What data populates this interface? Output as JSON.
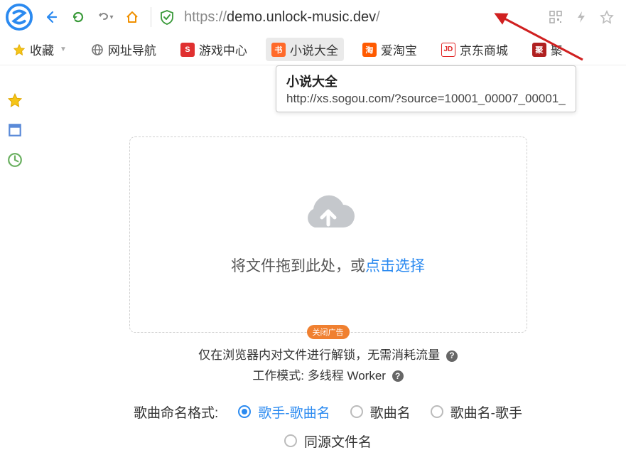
{
  "url": {
    "scheme": "https://",
    "host": "demo.unlock-music.dev",
    "path": "/"
  },
  "bookmarks": {
    "fav": "收藏",
    "items": [
      {
        "label": "网址导航",
        "icon_bg": "#888",
        "icon_text": "⊕"
      },
      {
        "label": "游戏中心",
        "icon_bg": "#e03030",
        "icon_text": "S"
      },
      {
        "label": "小说大全",
        "icon_bg": "#ff6a2a",
        "icon_text": "书"
      },
      {
        "label": "爱淘宝",
        "icon_bg": "#ff5a00",
        "icon_text": "淘"
      },
      {
        "label": "京东商城",
        "icon_bg": "#e02020",
        "icon_text": "JD"
      },
      {
        "label": "聚",
        "icon_bg": "#b02020",
        "icon_text": "聚"
      }
    ]
  },
  "tooltip": {
    "title": "小说大全",
    "url": "http://xs.sogou.com/?source=10001_00007_00001_"
  },
  "dropzone": {
    "prefix": "将文件拖到此处，或",
    "link": "点击选择"
  },
  "close_ad": "关闭广告",
  "info": {
    "line1": "仅在浏览器内对文件进行解锁，无需消耗流量",
    "line2": "工作模式: 多线程 Worker"
  },
  "naming": {
    "label": "歌曲命名格式:",
    "options": [
      "歌手-歌曲名",
      "歌曲名",
      "歌曲名-歌手",
      "同源文件名"
    ],
    "selected": 0
  }
}
